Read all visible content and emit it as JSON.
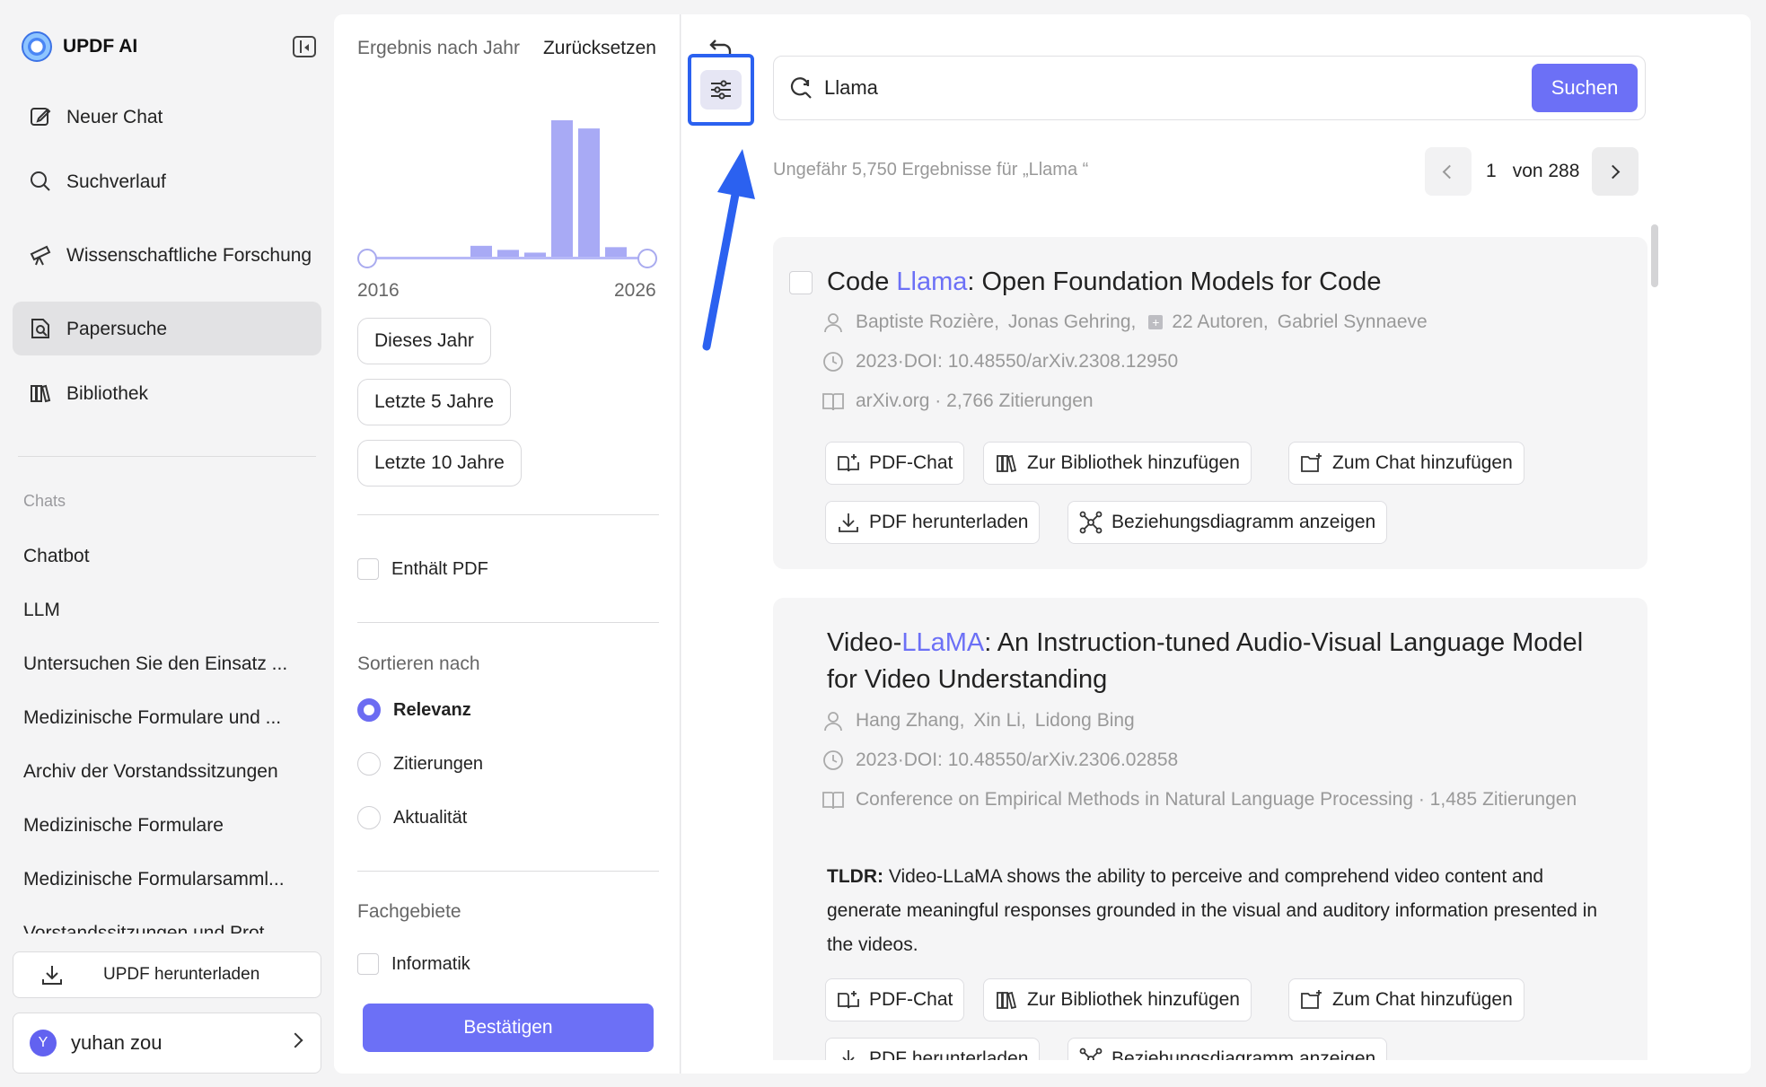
{
  "app": {
    "name": "UPDF AI"
  },
  "nav": [
    {
      "label": "Neuer Chat",
      "icon": "edit-icon"
    },
    {
      "label": "Suchverlauf",
      "icon": "search-icon"
    },
    {
      "label": "Wissenschaftliche Forschung",
      "icon": "telescope-icon"
    },
    {
      "label": "Papersuche",
      "icon": "paper-search-icon"
    },
    {
      "label": "Bibliothek",
      "icon": "library-icon"
    }
  ],
  "chats": {
    "heading": "Chats",
    "items": [
      "Chatbot",
      "LLM",
      "Untersuchen Sie den Einsatz ...",
      "Medizinische Formulare und ...",
      "Archiv der Vorstandssitzungen",
      "Medizinische Formulare",
      "Medizinische Formularsamml...",
      "Vorstandssitzungen und Prot..."
    ]
  },
  "download_label": "UPDF herunterladen",
  "user": {
    "initial": "Y",
    "name": "yuhan zou"
  },
  "filter": {
    "title": "Ergebnis nach Jahr",
    "reset": "Zurücksetzen",
    "year_start": "2016",
    "year_end": "2026",
    "histogram": [
      0.08,
      0.05,
      0.03,
      1.0,
      0.94,
      0.07
    ],
    "quick_years": [
      "Dieses Jahr",
      "Letzte 5 Jahre",
      "Letzte 10 Jahre"
    ],
    "contains_pdf": "Enthält PDF",
    "sort_heading": "Sortieren nach",
    "sort_options": [
      "Relevanz",
      "Zitierungen",
      "Aktualität"
    ],
    "selected_sort": "Relevanz",
    "fields_heading": "Fachgebiete",
    "fields": [
      "Informatik"
    ],
    "confirm": "Bestätigen"
  },
  "search": {
    "query": "Llama",
    "button": "Suchen",
    "result_count": "Ungefähr 5,750 Ergebnisse für „Llama “"
  },
  "pager": {
    "current": "1",
    "of_label": "von 288"
  },
  "results": [
    {
      "title_before": "Code ",
      "title_highlight": "Llama",
      "title_after": ": Open Foundation Models for Code",
      "author_1": "Baptiste Rozière,",
      "author_2": "Jonas Gehring,",
      "more_authors": "22 Autoren,",
      "author_last": "Gabriel Synnaeve",
      "date_doi": "2023·DOI: 10.48550/arXiv.2308.12950",
      "source": "arXiv.org · 2,766 Zitierungen",
      "actions": [
        "PDF-Chat",
        "Zur Bibliothek hinzufügen",
        "Zum Chat hinzufügen",
        "PDF herunterladen",
        "Beziehungsdiagramm anzeigen"
      ]
    },
    {
      "title_before": "Video-",
      "title_highlight": "LLaMA",
      "title_after": ": An Instruction-tuned Audio-Visual Language Model for Video Understanding",
      "authors": [
        "Hang Zhang,",
        "Xin Li,",
        "Lidong Bing"
      ],
      "date_doi": "2023·DOI: 10.48550/arXiv.2306.02858",
      "source": "Conference on Empirical Methods in Natural Language Processing · 1,485 Zitierungen",
      "tldr_label": "TLDR:",
      "tldr": " Video-LLaMA shows the ability to perceive and comprehend video content and generate meaningful responses grounded in the visual and auditory information presented in the videos.",
      "actions": [
        "PDF-Chat",
        "Zur Bibliothek hinzufügen",
        "Zum Chat hinzufügen",
        "PDF herunterladen",
        "Beziehungsdiagramm anzeigen"
      ]
    }
  ],
  "colors": {
    "accent": "#6c70f6",
    "annotation": "#2b61f0",
    "muted": "#999999"
  }
}
